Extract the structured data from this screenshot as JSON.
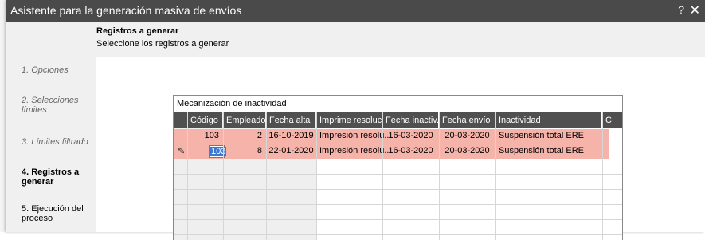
{
  "dialog": {
    "title": "Asistente para la generación masiva de envíos",
    "help_label": "?",
    "close_label": "✕"
  },
  "header": {
    "title": "Registros a generar",
    "subtitle": "Seleccione los registros a generar"
  },
  "steps": [
    {
      "label": "1. Opciones",
      "state": "done"
    },
    {
      "label": "2. Selecciones",
      "label2": "límites",
      "state": "done"
    },
    {
      "label": "3. Límites filtrado",
      "state": "done"
    },
    {
      "label": "4. Registros a",
      "label2": "generar",
      "state": "current"
    },
    {
      "label": "5. Ejecución del",
      "label2": "proceso",
      "state": "pending"
    }
  ],
  "panel": {
    "title": "Mecanización de inactividad"
  },
  "table": {
    "columns": [
      "Código",
      "Empleado",
      "Fecha alta",
      "Imprime resoluc...",
      "Fecha inactiv.",
      "Fecha envío",
      "Inactividad",
      "C"
    ],
    "rows": [
      {
        "codigo": "103",
        "empleado": "2",
        "fecha_alta": "16-10-2019",
        "imprime": "Impresión resolu...",
        "fecha_inactiv": "16-03-2020",
        "fecha_envio": "20-03-2020",
        "inactividad": "Suspensión total ERE"
      },
      {
        "codigo": "103",
        "empleado": "8",
        "fecha_alta": "22-01-2020",
        "imprime": "Impresión resolu...",
        "fecha_inactiv": "16-03-2020",
        "fecha_envio": "20-03-2020",
        "inactividad": "Suspensión total ERE"
      }
    ],
    "edit_marker": "✎"
  },
  "colors": {
    "titlebar": "#4a4a4a",
    "row_highlight": "#f5b3a9",
    "header_bg": "#505050",
    "selection": "#3a78d4"
  }
}
